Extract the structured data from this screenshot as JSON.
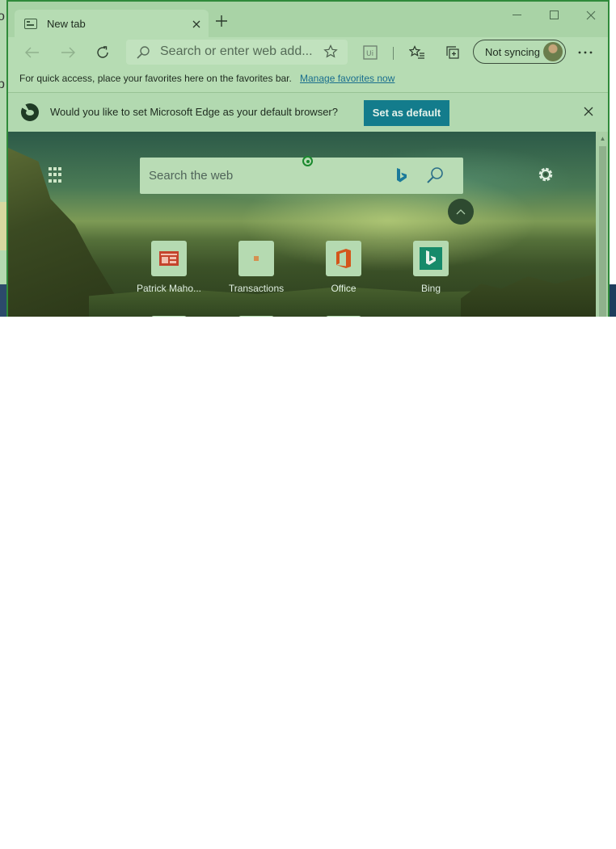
{
  "browser": {
    "tab": {
      "title": "New tab"
    },
    "address_bar": {
      "placeholder": "Search or enter web add..."
    },
    "profile": {
      "label": "Not syncing"
    }
  },
  "favorites_bar": {
    "text": "For quick access, place your favorites here on the favorites bar.",
    "link": "Manage favorites now"
  },
  "default_prompt": {
    "text": "Would you like to set Microsoft Edge as your default browser?",
    "button": "Set as default"
  },
  "new_tab_page": {
    "search_placeholder": "Search the web",
    "tiles": [
      {
        "label": "Patrick Maho...",
        "icon": "powerpoint-icon"
      },
      {
        "label": "Transactions",
        "icon": "transactions-icon"
      },
      {
        "label": "Office",
        "icon": "office-icon"
      },
      {
        "label": "Bing",
        "icon": "bing-icon"
      }
    ]
  },
  "desktop_edge": {
    "glyphs": [
      "o",
      "p"
    ]
  },
  "colors": {
    "accent": "#137c8c",
    "window_border": "#2f8a3a",
    "chrome_tint": "#b2d9b0"
  }
}
